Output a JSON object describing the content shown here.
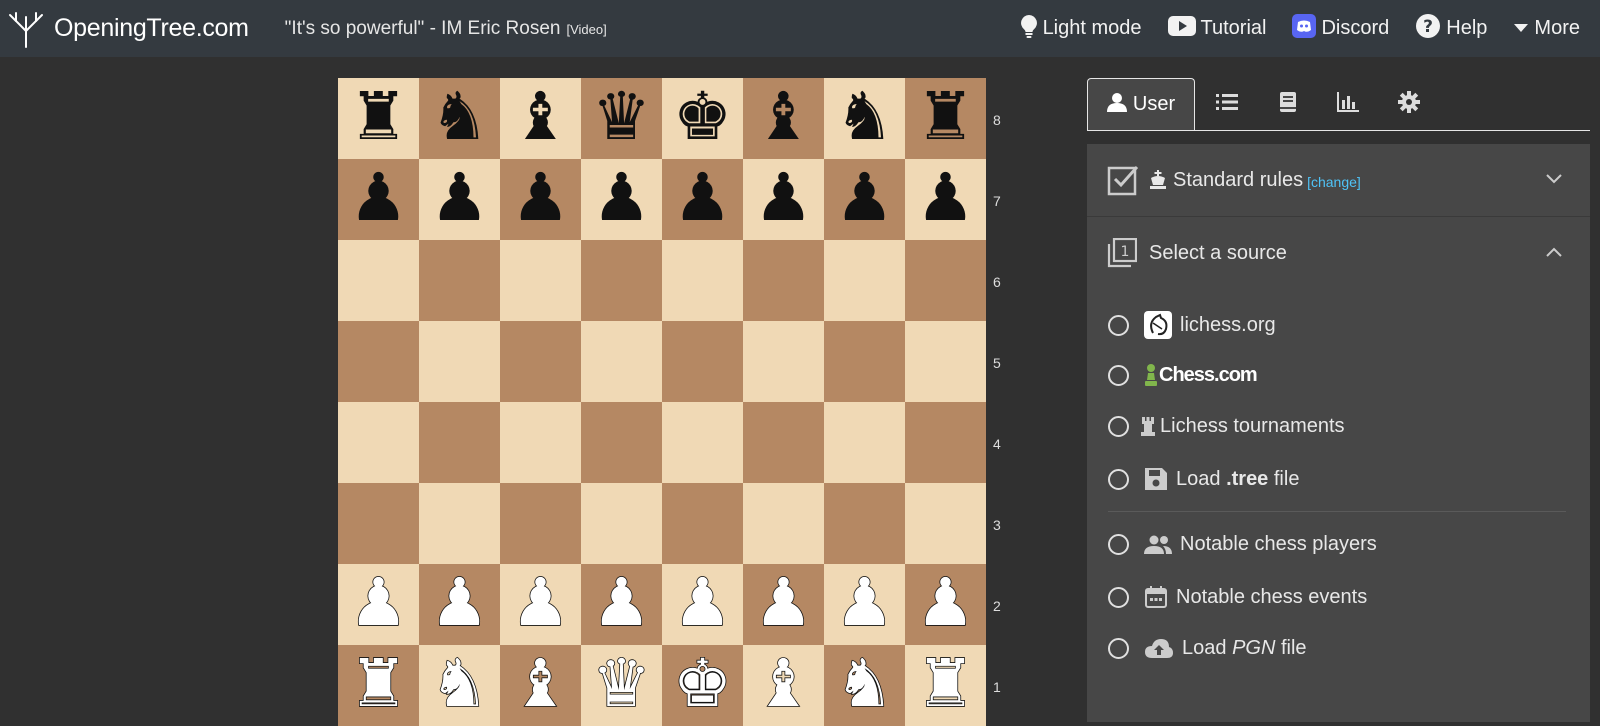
{
  "header": {
    "brand": "OpeningTree.com",
    "headline": "\"It's so powerful\" - IM Eric Rosen",
    "headline_tag": "[Video]",
    "nav": [
      {
        "label": "Light mode",
        "icon": "lightbulb-icon"
      },
      {
        "label": "Tutorial",
        "icon": "youtube-icon"
      },
      {
        "label": "Discord",
        "icon": "discord-icon"
      },
      {
        "label": "Help",
        "icon": "help-icon"
      },
      {
        "label": "More",
        "icon": "caret-down-icon"
      }
    ]
  },
  "board": {
    "ranks": [
      "8",
      "7",
      "6",
      "5",
      "4",
      "3",
      "2",
      "1"
    ],
    "rows": [
      [
        "bR",
        "bN",
        "bB",
        "bQ",
        "bK",
        "bB",
        "bN",
        "bR"
      ],
      [
        "bP",
        "bP",
        "bP",
        "bP",
        "bP",
        "bP",
        "bP",
        "bP"
      ],
      [
        "",
        "",
        "",
        "",
        "",
        "",
        "",
        ""
      ],
      [
        "",
        "",
        "",
        "",
        "",
        "",
        "",
        ""
      ],
      [
        "",
        "",
        "",
        "",
        "",
        "",
        "",
        ""
      ],
      [
        "",
        "",
        "",
        "",
        "",
        "",
        "",
        ""
      ],
      [
        "wP",
        "wP",
        "wP",
        "wP",
        "wP",
        "wP",
        "wP",
        "wP"
      ],
      [
        "wR",
        "wN",
        "wB",
        "wQ",
        "wK",
        "wB",
        "wN",
        "wR"
      ]
    ],
    "colors": {
      "light": "#f0d9b5",
      "dark": "#b58863"
    }
  },
  "tabs": {
    "user_label": "User",
    "icons": [
      "user-icon",
      "list-icon",
      "book-icon",
      "bar-chart-icon",
      "gear-icon"
    ]
  },
  "panel": {
    "rules": {
      "label": "Standard rules",
      "change_link": "[change]"
    },
    "source": {
      "label": "Select a source"
    },
    "options": {
      "lichess": "lichess.org",
      "chesscom": "Chess.com",
      "lichess_tournaments": "Lichess tournaments",
      "tree_file_prefix": "Load",
      "tree_file_strong": ".tree",
      "tree_file_suffix": "file",
      "notable_players": "Notable chess players",
      "notable_events": "Notable chess events",
      "pgn_prefix": "Load",
      "pgn_em": "PGN",
      "pgn_suffix": "file"
    }
  }
}
